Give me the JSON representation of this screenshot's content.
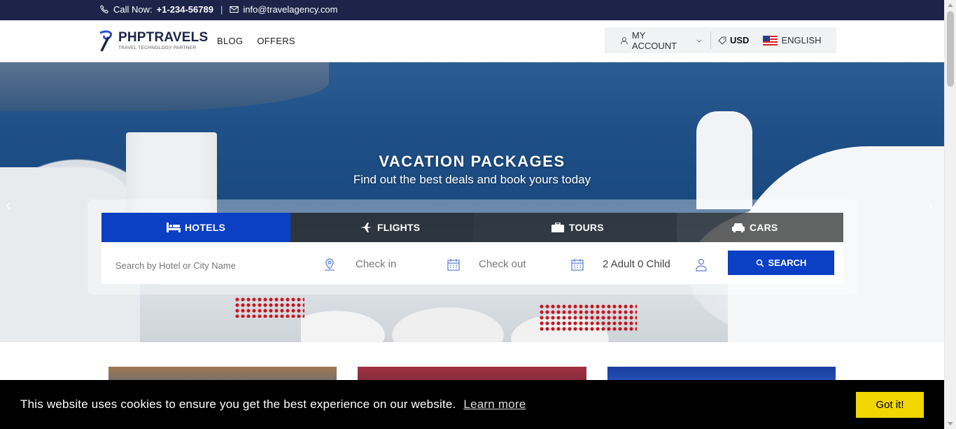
{
  "topbar": {
    "call_label": "Call Now:",
    "phone": "+1-234-56789",
    "separator": "|",
    "email": "info@travelagency.com"
  },
  "header": {
    "logo_name": "PHPTRAVELS",
    "logo_tagline": "TRAVEL TECHNOLOGY PARTNER",
    "nav": [
      "BLOG",
      "OFFERS"
    ],
    "account_label": "MY ACCOUNT",
    "currency": "USD",
    "language": "ENGLISH"
  },
  "hero": {
    "title": "VACATION PACKAGES",
    "subtitle": "Find out the best deals and book yours today"
  },
  "search": {
    "tabs": [
      "HOTELS",
      "FLIGHTS",
      "TOURS",
      "CARS"
    ],
    "active_tab": "HOTELS",
    "destination_placeholder": "Search by Hotel or City Name",
    "checkin_label": "Check in",
    "checkout_label": "Check out",
    "guests": "2 Adult 0 Child",
    "search_button": "SEARCH"
  },
  "cookie": {
    "message": "This website uses cookies to ensure you get the best experience on our website.",
    "learn_more": "Learn more",
    "accept": "Got it!"
  },
  "colors": {
    "topbar": "#1c2549",
    "brand_blue": "#0b3fc4",
    "cookie_button": "#f1d600"
  }
}
